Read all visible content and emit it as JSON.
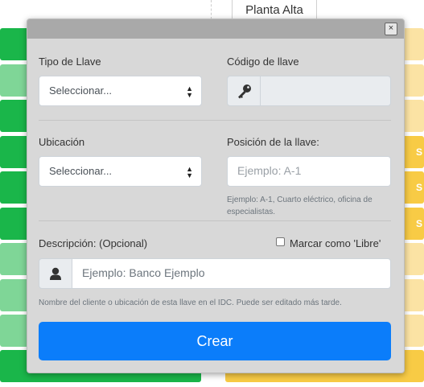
{
  "background": {
    "tab_label": "Planta Alta",
    "badge_letter": "S"
  },
  "modal": {
    "close_glyph": "×",
    "key_type": {
      "label": "Tipo de Llave",
      "selected": "Seleccionar..."
    },
    "key_code": {
      "label": "Código de llave",
      "icon": "key-icon",
      "value": ""
    },
    "location": {
      "label": "Ubicación",
      "selected": "Seleccionar..."
    },
    "key_position": {
      "label": "Posición de la llave:",
      "placeholder": "Ejemplo: A-1",
      "help": "Ejemplo: A-1, Cuarto eléctrico, oficina de especialistas."
    },
    "description": {
      "label": "Descripción: (Opcional)",
      "icon": "user-icon",
      "placeholder": "Ejemplo: Banco Ejemplo",
      "help": "Nombre del cliente o ubicación de esta llave en el IDC. Puede ser editado más tarde."
    },
    "mark_free": {
      "label": "Marcar como 'Libre'",
      "checked": false
    },
    "submit_label": "Crear"
  },
  "colors": {
    "primary": "#0b7dfa",
    "green_dark": "#1ab64a",
    "green_light": "#7fd697",
    "yellow_dark": "#f8cb45",
    "yellow_light": "#fbe3a4"
  }
}
